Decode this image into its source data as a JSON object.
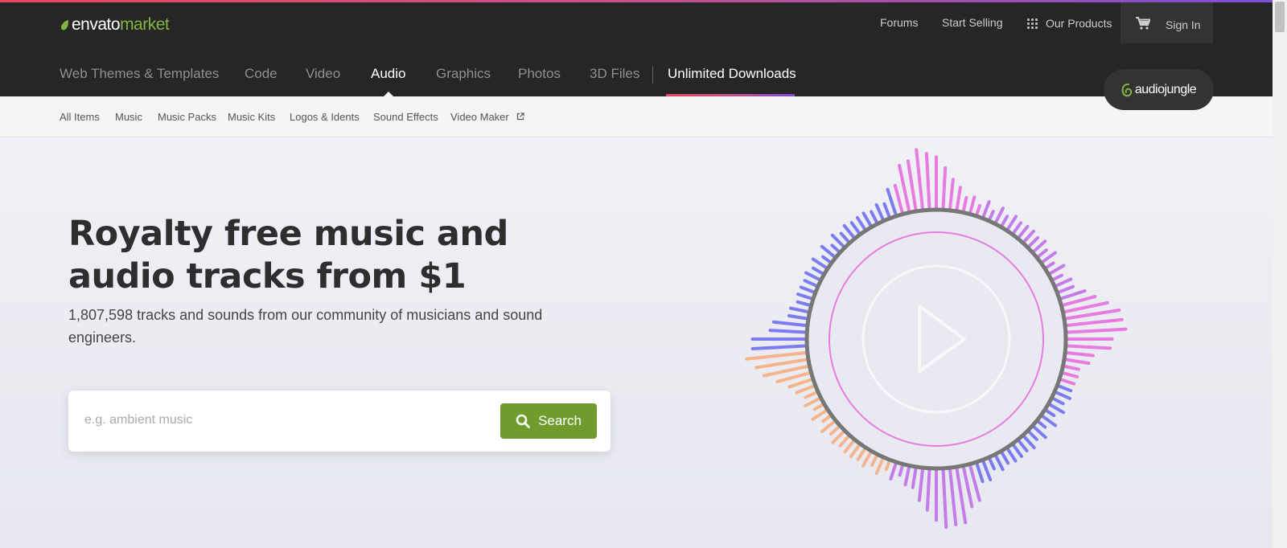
{
  "header": {
    "logo": {
      "brand": "envato",
      "product": "market"
    },
    "top_links": {
      "forums": "Forums",
      "start_selling": "Start Selling",
      "our_products": "Our Products",
      "sign_in": "Sign In"
    },
    "main_nav": [
      {
        "label": "Web Themes & Templates",
        "active": false
      },
      {
        "label": "Code",
        "active": false
      },
      {
        "label": "Video",
        "active": false
      },
      {
        "label": "Audio",
        "active": true
      },
      {
        "label": "Graphics",
        "active": false
      },
      {
        "label": "Photos",
        "active": false
      },
      {
        "label": "3D Files",
        "active": false
      },
      {
        "label": "Unlimited Downloads",
        "active": false
      }
    ],
    "site_badge": "audiojungle"
  },
  "sub_nav": [
    {
      "label": "All Items"
    },
    {
      "label": "Music"
    },
    {
      "label": "Music Packs"
    },
    {
      "label": "Music Kits"
    },
    {
      "label": "Logos & Idents"
    },
    {
      "label": "Sound Effects"
    },
    {
      "label": "Video Maker",
      "external": true
    }
  ],
  "hero": {
    "title": "Royalty free music and audio tracks from $1",
    "subtitle": "1,807,598 tracks and sounds from our community of musicians and sound engineers.",
    "search": {
      "placeholder": "e.g. ambient music",
      "value": "",
      "button_label": "Search"
    }
  },
  "icons": {
    "logo": "leaf-icon",
    "our_products": "grid-icon",
    "cart": "cart-icon",
    "external": "external-link-icon",
    "search": "search-icon",
    "visual": "play-icon"
  },
  "colors": {
    "header_bg": "#262626",
    "brand_green": "#82b440",
    "search_button": "#6f9c2c",
    "accent_pink": "#e8475f",
    "accent_purple": "#7b4fd6",
    "wave_pink": "#e77be0",
    "wave_blue": "#7b7cf0",
    "wave_orange": "#f4b48c",
    "wave_violet": "#c47ce8"
  }
}
